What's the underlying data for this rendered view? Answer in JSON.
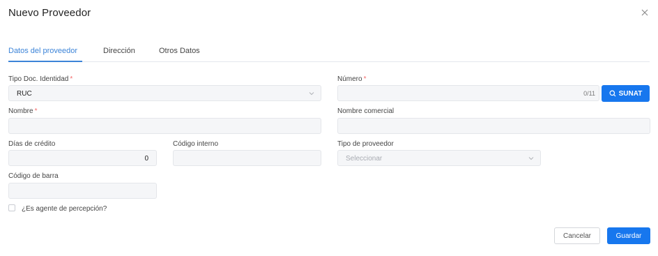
{
  "dialog": {
    "title": "Nuevo Proveedor"
  },
  "tabs": [
    {
      "label": "Datos del proveedor"
    },
    {
      "label": "Dirección"
    },
    {
      "label": "Otros Datos"
    }
  ],
  "form": {
    "tipo_doc": {
      "label": "Tipo Doc. Identidad",
      "required_mark": "*",
      "value": "RUC"
    },
    "numero": {
      "label": "Número",
      "required_mark": "*",
      "counter": "0/11",
      "sunat_label": "SUNAT"
    },
    "nombre": {
      "label": "Nombre",
      "required_mark": "*"
    },
    "nombre_comercial": {
      "label": "Nombre comercial"
    },
    "dias_credito": {
      "label": "Días de crédito",
      "value": "0"
    },
    "codigo_interno": {
      "label": "Código interno"
    },
    "tipo_proveedor": {
      "label": "Tipo de proveedor",
      "placeholder": "Seleccionar"
    },
    "codigo_barra": {
      "label": "Código de barra"
    },
    "agente_percepcion": {
      "label": "¿Es agente de percepción?",
      "checked": false
    }
  },
  "footer": {
    "cancel_label": "Cancelar",
    "save_label": "Guardar"
  },
  "colors": {
    "accent": "#1777ee",
    "tab_active": "#3c84d8",
    "required": "#f56c6c",
    "field_bg": "#f5f6f8"
  },
  "icons": {
    "close": "close-icon",
    "search": "search-icon",
    "chevron": "chevron-down-icon"
  }
}
